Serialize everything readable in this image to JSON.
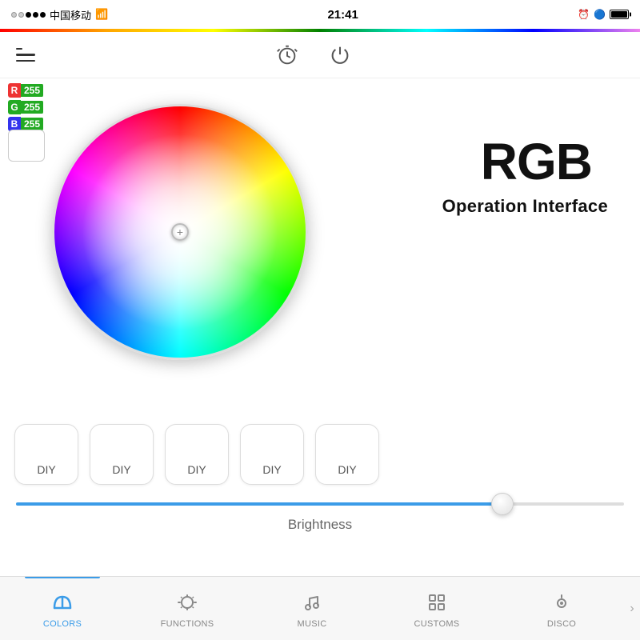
{
  "statusBar": {
    "carrier": "中国移动",
    "time": "21:41",
    "wifi": "▲"
  },
  "nav": {
    "menuLabel": "menu",
    "alarmLabel": "alarm",
    "powerLabel": "power"
  },
  "rgb": {
    "r_label": "R",
    "g_label": "G",
    "b_label": "B",
    "r_value": "255",
    "g_value": "255",
    "b_value": "255",
    "title": "RGB",
    "subtitle": "Operation Interface"
  },
  "diy": {
    "buttons": [
      "DIY",
      "DIY",
      "DIY",
      "DIY",
      "DIY"
    ]
  },
  "brightness": {
    "label": "Brightness"
  },
  "tabs": [
    {
      "id": "colors",
      "label": "COLORS",
      "active": true
    },
    {
      "id": "functions",
      "label": "FUNCTIONS",
      "active": false
    },
    {
      "id": "music",
      "label": "MUSIC",
      "active": false
    },
    {
      "id": "customs",
      "label": "CUSTOMS",
      "active": false
    },
    {
      "id": "disco",
      "label": "DISCO",
      "active": false
    }
  ]
}
